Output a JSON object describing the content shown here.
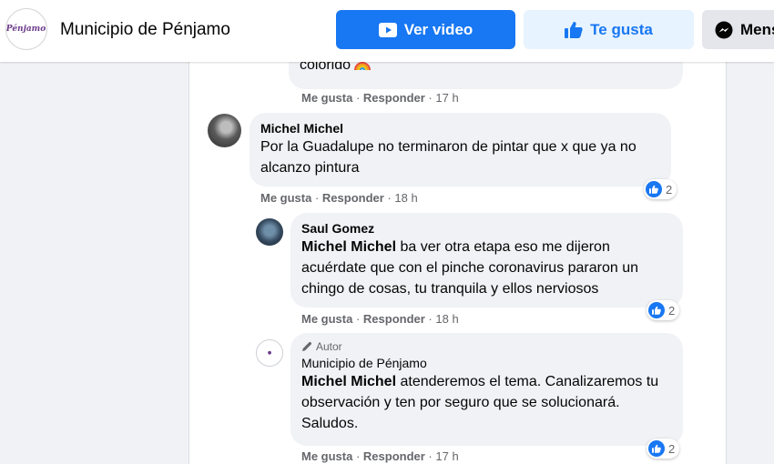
{
  "header": {
    "page_name": "Municipio de Pénjamo",
    "logo_text": "Pénjamo",
    "buttons": {
      "video": "Ver video",
      "like": "Te gusta",
      "message": "Mensaje"
    },
    "colors": {
      "primary": "#1877f2",
      "like_bg": "#e7f3ff"
    }
  },
  "comments": [
    {
      "text": "colorido",
      "emoji": "rainbow",
      "actions": {
        "like": "Me gusta",
        "reply": "Responder",
        "time": "17 h"
      }
    },
    {
      "author": "Michel Michel",
      "text": "Por la Guadalupe no terminaron de pintar que x que ya no alcanzo pintura",
      "actions": {
        "like": "Me gusta",
        "reply": "Responder",
        "time": "18 h"
      },
      "reactions": "2"
    },
    {
      "author": "Saul Gomez",
      "mention": "Michel Michel",
      "text": " ba ver otra etapa eso me dijeron acuérdate que con el pinche coronavirus pararon un chingo de cosas, tu tranquila y ellos nerviosos",
      "actions": {
        "like": "Me gusta",
        "reply": "Responder",
        "time": "18 h"
      },
      "reactions": "2"
    },
    {
      "badge": "Autor",
      "author": "Municipio de Pénjamo",
      "mention": "Michel Michel",
      "text": " atenderemos el tema. Canalizaremos tu observación y ten por seguro que se solucionará. Saludos.",
      "actions": {
        "like": "Me gusta",
        "reply": "Responder",
        "time": "17 h"
      },
      "reactions": "2"
    }
  ]
}
